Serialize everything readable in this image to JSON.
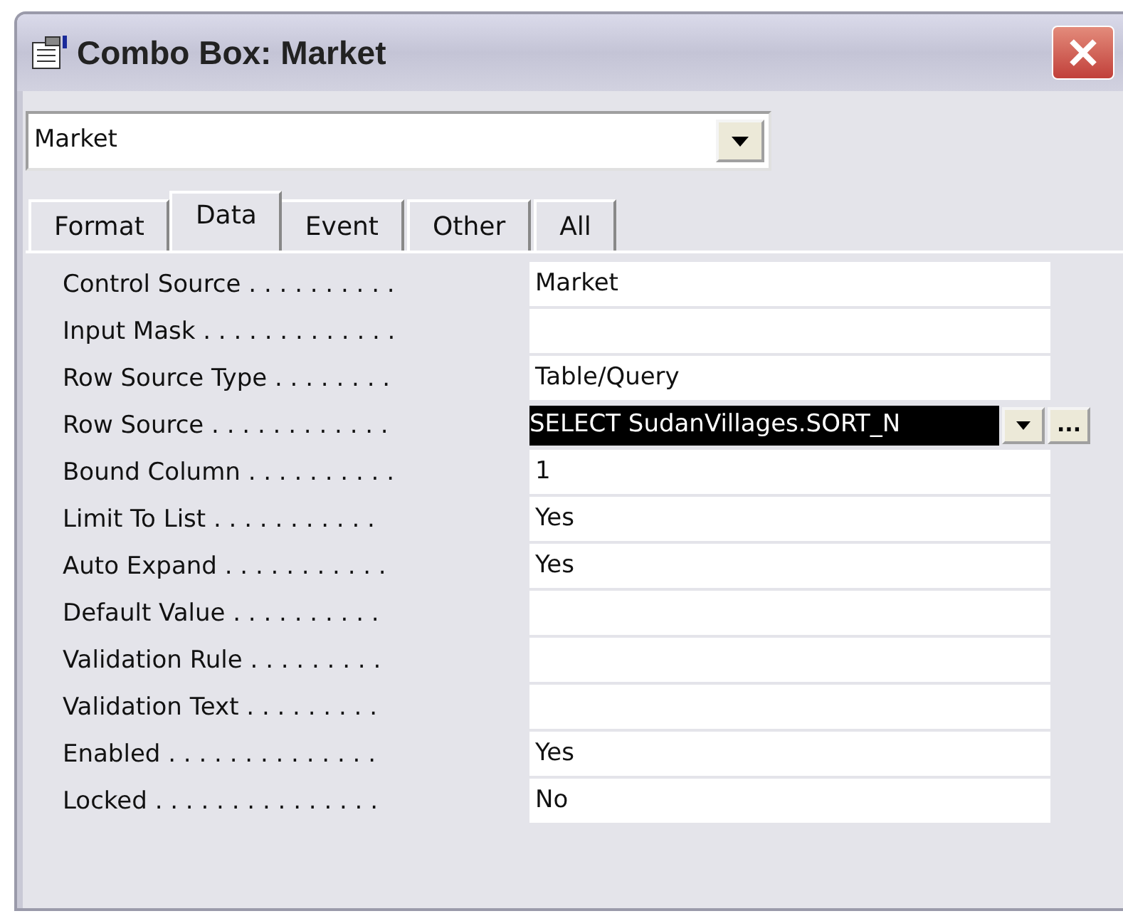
{
  "window": {
    "title": "Combo Box: Market"
  },
  "object_selector": {
    "value": "Market"
  },
  "tabs": [
    {
      "label": "Format",
      "selected": false
    },
    {
      "label": "Data",
      "selected": true
    },
    {
      "label": "Event",
      "selected": false
    },
    {
      "label": "Other",
      "selected": false
    },
    {
      "label": "All",
      "selected": false
    }
  ],
  "properties": [
    {
      "label": "Control Source . . . . . . . . . .",
      "value": "Market",
      "selected": false
    },
    {
      "label": "Input Mask . . . . . . . . . . . . .",
      "selected": false
    },
    {
      "label": "Row Source Type . . . . . . . .",
      "value": "Table/Query",
      "selected": false
    },
    {
      "label": "Row Source . . . . . . . . . . . .",
      "value": "SELECT SudanVillages.SORT_N",
      "selected": true,
      "builder": "..."
    },
    {
      "label": "Bound Column . . . . . . . . . .",
      "value": "1",
      "selected": false
    },
    {
      "label": "Limit To List . . . . . . . . . . .",
      "value": "Yes",
      "selected": false
    },
    {
      "label": "Auto Expand . . . . . . . . . . .",
      "value": "Yes",
      "selected": false
    },
    {
      "label": "Default Value . . . . . . . . . .",
      "selected": false
    },
    {
      "label": "Validation Rule . . . . . . . . .",
      "selected": false
    },
    {
      "label": "Validation Text . . . . . . . . .",
      "selected": false
    },
    {
      "label": "Enabled . . . . . . . . . . . . . .",
      "value": "Yes",
      "selected": false
    },
    {
      "label": "Locked . . . . . . . . . . . . . . .",
      "value": "No",
      "selected": false
    }
  ]
}
